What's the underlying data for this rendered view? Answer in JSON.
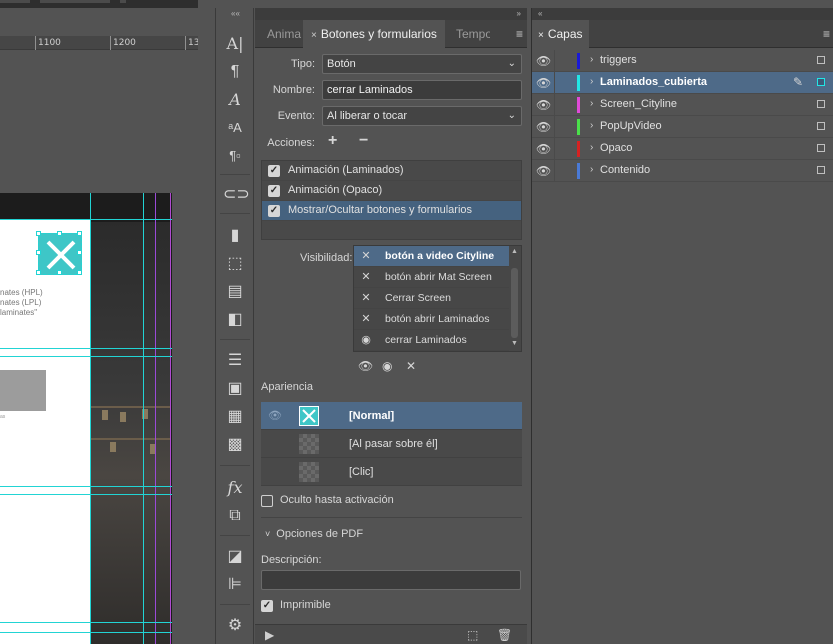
{
  "ruler": {
    "ticks": [
      "1100",
      "1200",
      "13"
    ]
  },
  "canvas": {
    "text_lines": [
      "nates (HPL)",
      "nates (LPL)",
      "laminates\""
    ],
    "small_caption": "as"
  },
  "toolstrip": {
    "icons": [
      "character-icon",
      "paragraph-icon",
      "glyphs-icon",
      "character-styles-icon",
      "paragraph-styles-icon",
      "hyperlinks-icon",
      "bookmarks-icon",
      "object-states-icon",
      "media-icon",
      "buttons-forms-icon",
      "lines-icon",
      "gradient-icon",
      "image-library-icon",
      "swatches-icon",
      "effects-icon",
      "transform-icon",
      "pathfinder-icon",
      "align-icon",
      "properties-icon"
    ]
  },
  "buttons_panel": {
    "collapse": "»",
    "tabs": [
      {
        "label": "Anima",
        "active": false
      },
      {
        "label": "Botones y formularios",
        "active": true
      },
      {
        "label": "Tempo",
        "active": false
      }
    ],
    "tab_close": "×",
    "menu": "≡",
    "tipo_label": "Tipo:",
    "tipo_value": "Botón",
    "nombre_label": "Nombre:",
    "nombre_value": "cerrar Laminados",
    "evento_label": "Evento:",
    "evento_value": "Al liberar o tocar",
    "acciones_label": "Acciones:",
    "add": "+",
    "remove": "−",
    "actions": [
      {
        "label": "Animación (Laminados)",
        "checked": true,
        "selected": false
      },
      {
        "label": "Animación (Opaco)",
        "checked": true,
        "selected": false
      },
      {
        "label": "Mostrar/Ocultar botones y formularios",
        "checked": true,
        "selected": true
      }
    ],
    "visibilidad_label": "Visibilidad:",
    "visibility": [
      {
        "icon": "✕",
        "label": "botón a video Cityline",
        "selected": true
      },
      {
        "icon": "✕",
        "label": "botón abrir Mat Screen",
        "selected": false
      },
      {
        "icon": "✕",
        "label": "Cerrar Screen",
        "selected": false
      },
      {
        "icon": "✕",
        "label": "botón abrir Laminados",
        "selected": false
      },
      {
        "icon": "◉",
        "label": "cerrar Laminados",
        "selected": false
      }
    ],
    "vis_buttons": [
      "👁",
      "◉",
      "✕"
    ],
    "apariencia_label": "Apariencia",
    "appearances": [
      {
        "label": "[Normal]",
        "selected": true
      },
      {
        "label": "[Al pasar sobre él]",
        "selected": false
      },
      {
        "label": "[Clic]",
        "selected": false
      }
    ],
    "oculto_label": "Oculto hasta activación",
    "pdf_options_label": "Opciones de PDF",
    "descripcion_label": "Descripción:",
    "descripcion_value": "",
    "imprimible_label": "Imprimible",
    "check": "✓",
    "dropdown": "⌄",
    "expand": "›",
    "collapse_down": "˅",
    "eye": "👁",
    "pen": "✎",
    "scroll_up": "▲",
    "scroll_down": "▼",
    "footer": [
      "▶",
      "⬚",
      "🗑"
    ]
  },
  "layers_panel": {
    "collapse": "«",
    "tab": "Capas",
    "layers": [
      {
        "name": "triggers",
        "color": "#1a1ad6",
        "selected": false
      },
      {
        "name": "Laminados_cubierta",
        "color": "#22e6e6",
        "selected": true
      },
      {
        "name": "Screen_Cityline",
        "color": "#e04ad8",
        "selected": false
      },
      {
        "name": "PopUpVideo",
        "color": "#4ae04a",
        "selected": false
      },
      {
        "name": "Opaco",
        "color": "#d62222",
        "selected": false
      },
      {
        "name": "Contenido",
        "color": "#4a7ad6",
        "selected": false
      }
    ]
  }
}
